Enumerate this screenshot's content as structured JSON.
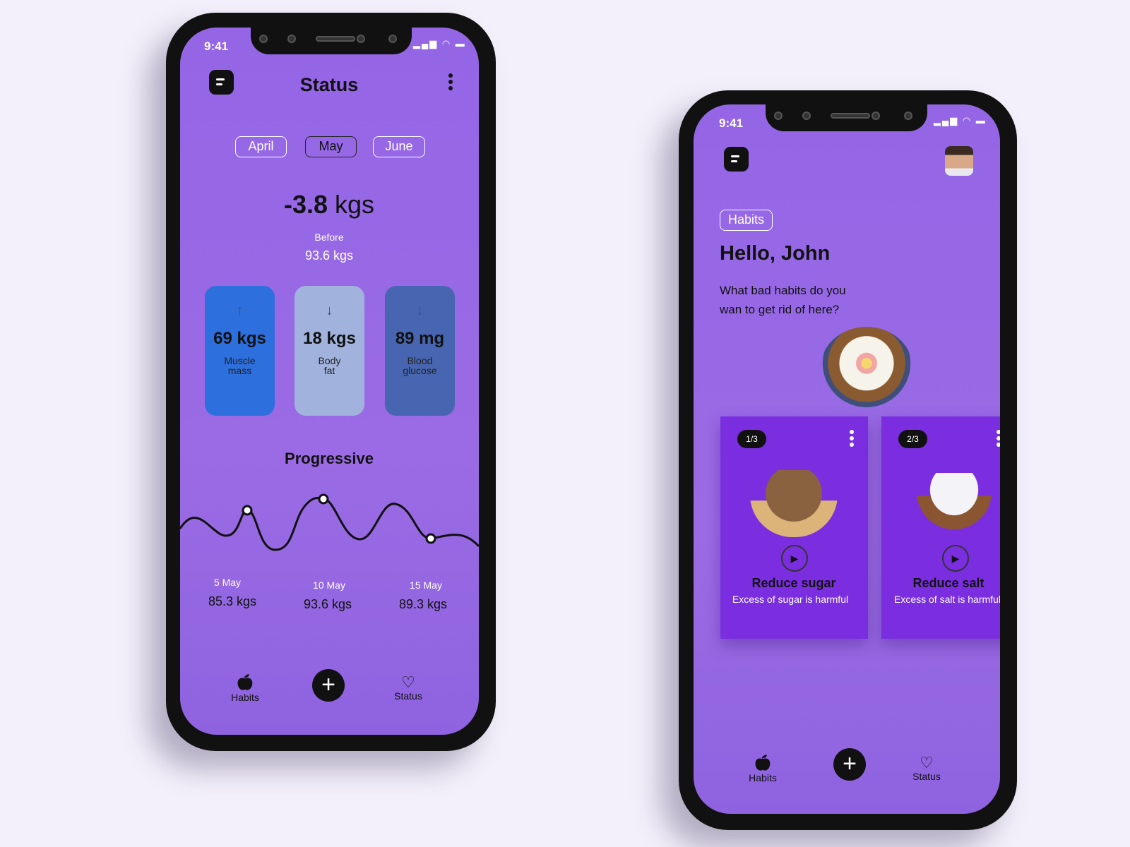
{
  "status_screen": {
    "time": "9:41",
    "title": "Status",
    "months": [
      "April",
      "May",
      "June"
    ],
    "change": {
      "value": "-3.8",
      "unit": "kgs"
    },
    "before_label": "Before",
    "before_value": "93.6 kgs",
    "stats": [
      {
        "value": "69 kgs",
        "label1": "Muscle",
        "label2": "mass",
        "trend": "up",
        "color": "#2d6fdc"
      },
      {
        "value": "18 kgs",
        "label1": "Body",
        "label2": "fat",
        "trend": "down",
        "color": "#a1b2dc"
      },
      {
        "value": "89 mg",
        "label1": "Blood",
        "label2": "glucose",
        "trend": "down",
        "color": "#4765b0"
      }
    ],
    "progress_title": "Progressive",
    "points": [
      {
        "date": "5 May",
        "value": "85.3 kgs"
      },
      {
        "date": "10 May",
        "value": "93.6 kgs"
      },
      {
        "date": "15 May",
        "value": "89.3 kgs"
      }
    ],
    "nav": {
      "habits": "Habits",
      "status": "Status",
      "add": "+"
    }
  },
  "habits_screen": {
    "time": "9:41",
    "tag": "Habits",
    "greeting": "Hello, John",
    "question1": "What bad habits do you",
    "question2": "wan to get rid of here?",
    "cards": [
      {
        "badge": "1/3",
        "title": "Reduce sugar",
        "subtitle": "Excess of sugar is harmful"
      },
      {
        "badge": "2/3",
        "title": "Reduce salt",
        "subtitle": "Excess of salt is harmful"
      }
    ],
    "nav": {
      "habits": "Habits",
      "status": "Status",
      "add": "+"
    }
  }
}
